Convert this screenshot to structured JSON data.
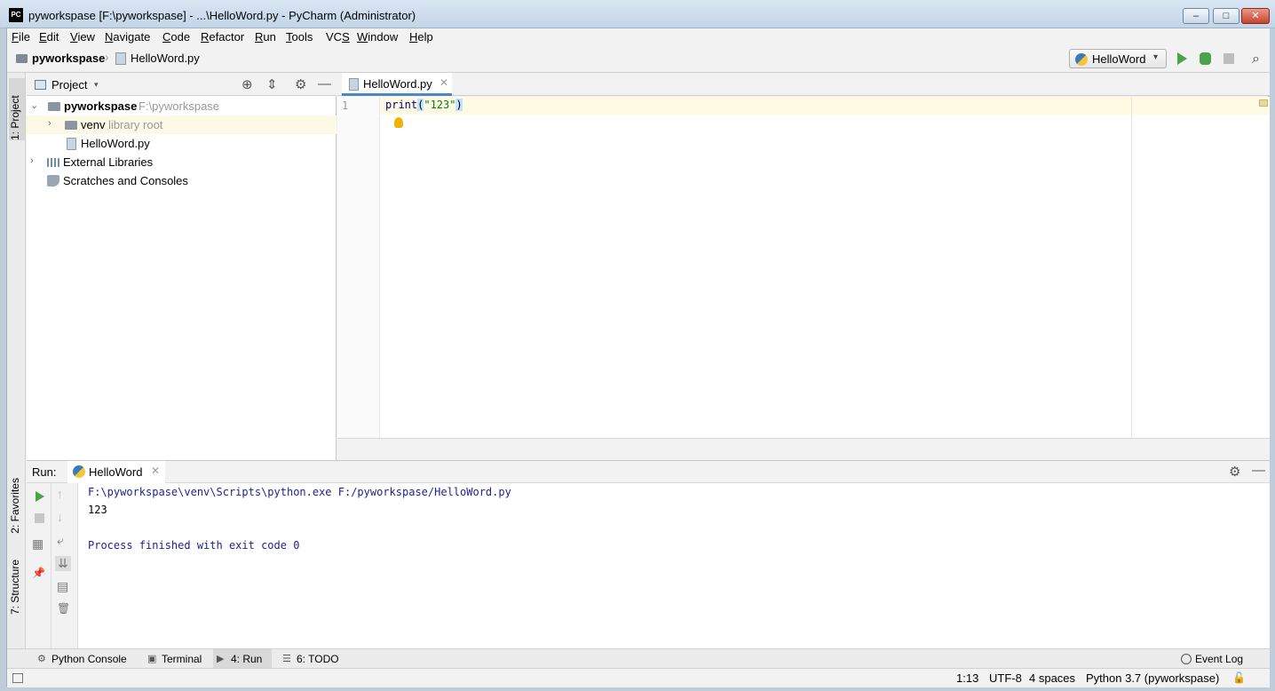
{
  "window": {
    "title": "pyworkspase [F:\\pyworkspase] - ...\\HelloWord.py - PyCharm (Administrator)",
    "logo_text": "PC",
    "min_label": "–",
    "max_label": "□",
    "close_label": "✕"
  },
  "menu": [
    "File",
    "Edit",
    "View",
    "Navigate",
    "Code",
    "Refactor",
    "Run",
    "Tools",
    "VCS",
    "Window",
    "Help"
  ],
  "menu_mnemonic": [
    "F",
    "E",
    "V",
    "N",
    "C",
    "R",
    "R",
    "T",
    "S",
    "W",
    "H"
  ],
  "breadcrumb": {
    "project": "pyworkspase",
    "separator": "›",
    "file": "HelloWord.py"
  },
  "run_config": {
    "label": "HelloWord",
    "arrow": "▾"
  },
  "toolbar": {
    "search_icon": "⌕"
  },
  "side_tabs": {
    "project": "1: Project",
    "favorites": "2: Favorites",
    "structure": "7: Structure"
  },
  "project_panel": {
    "title": "Project",
    "arrow": "▾",
    "tools": {
      "locate": "⊕",
      "collapse": "⇕",
      "settings": "⚙",
      "hide": "—"
    },
    "tree": [
      {
        "arrow": "⌄",
        "label": "pyworkspase",
        "hint": "F:\\pyworkspase"
      },
      {
        "arrow": "›",
        "label": "venv",
        "hint": "library root"
      },
      {
        "label": "HelloWord.py"
      },
      {
        "arrow": "›",
        "label": "External Libraries"
      },
      {
        "label": "Scratches and Consoles"
      }
    ]
  },
  "editor": {
    "tab_label": "HelloWord.py",
    "tab_close": "✕",
    "line_number": "1",
    "code": {
      "fn": "print",
      "open": "(",
      "str": "\"123\"",
      "close": ")"
    }
  },
  "run_panel": {
    "label": "Run:",
    "tab_label": "HelloWord",
    "tab_close": "✕",
    "gear": "⚙",
    "hide": "—",
    "toolbar": {
      "up": "↑",
      "down": "↓",
      "wrap": "⤶",
      "scroll_end": "⇊",
      "print": "▤",
      "trash": "🗑",
      "layout": "▦",
      "pin": "📌"
    },
    "console": [
      "F:\\pyworkspase\\venv\\Scripts\\python.exe F:/pyworkspase/HelloWord.py",
      "123",
      "Process finished with exit code 0"
    ]
  },
  "tool_tabs": [
    {
      "icon": "⚙",
      "label": "Python Console"
    },
    {
      "icon": "▣",
      "label": "Terminal"
    },
    {
      "icon": "▶",
      "label": "4: Run"
    },
    {
      "icon": "☰",
      "label": "6: TODO"
    }
  ],
  "event_log": "Event Log",
  "status": {
    "position": "1:13",
    "encoding": "UTF-8",
    "indent": "4 spaces",
    "interpreter": "Python 3.7 (pyworkspase)",
    "lock": "🔓"
  }
}
